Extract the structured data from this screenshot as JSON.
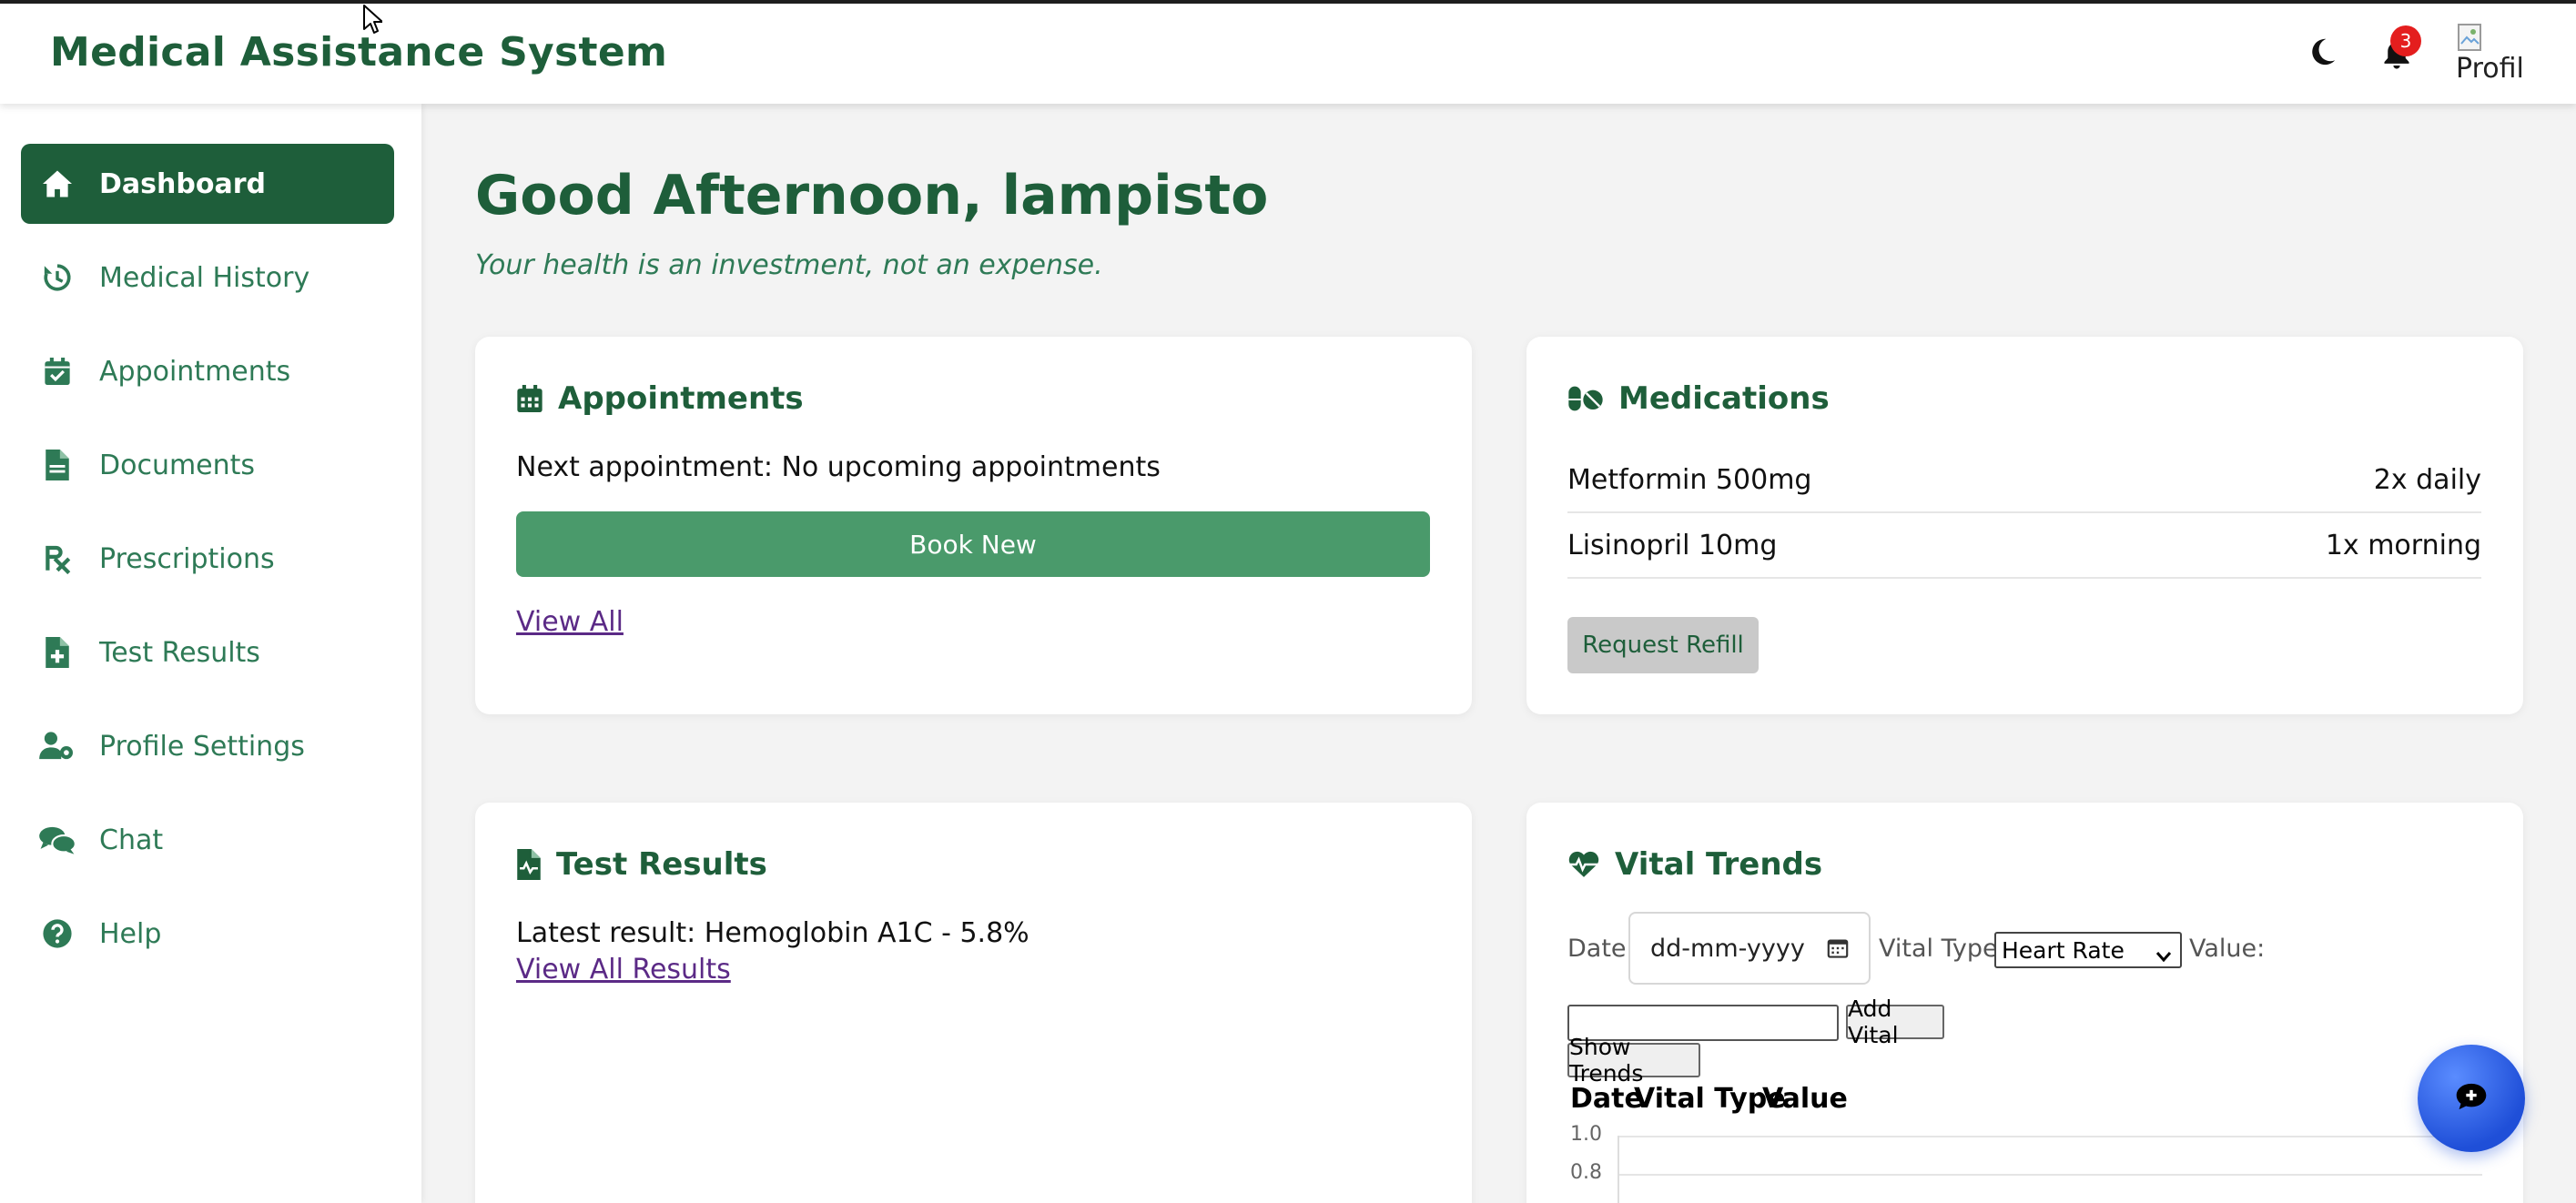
{
  "app": {
    "title": "Medical Assistance System",
    "notification_count": "3",
    "avatar_alt": "Profile"
  },
  "sidebar": {
    "items": [
      {
        "label": "Dashboard",
        "icon": "home-icon",
        "active": true
      },
      {
        "label": "Medical History",
        "icon": "history-icon"
      },
      {
        "label": "Appointments",
        "icon": "calendar-check-icon"
      },
      {
        "label": "Documents",
        "icon": "document-icon"
      },
      {
        "label": "Prescriptions",
        "icon": "prescription-icon"
      },
      {
        "label": "Test Results",
        "icon": "file-medical-icon"
      },
      {
        "label": "Profile Settings",
        "icon": "user-gear-icon"
      },
      {
        "label": "Chat",
        "icon": "chat-bubbles-icon"
      },
      {
        "label": "Help",
        "icon": "help-circle-icon"
      }
    ]
  },
  "main": {
    "greeting": "Good Afternoon, lampisto",
    "tagline": "Your health is an investment, not an expense."
  },
  "appointments": {
    "title": "Appointments",
    "next_text": "Next appointment: No upcoming appointments",
    "book_label": "Book New",
    "view_all_label": "View All"
  },
  "medications": {
    "title": "Medications",
    "items": [
      {
        "name": "Metformin 500mg",
        "schedule": "2x daily"
      },
      {
        "name": "Lisinopril 10mg",
        "schedule": "1x morning"
      }
    ],
    "refill_label": "Request Refill"
  },
  "test_results": {
    "title": "Test Results",
    "latest_text": "Latest result: Hemoglobin A1C - 5.8%",
    "view_all_label": "View All Results"
  },
  "vitals": {
    "title": "Vital Trends",
    "date_label": "Date:",
    "date_placeholder": "dd-mm-yyyy",
    "type_label": "Vital Type:",
    "type_selected": "Heart Rate",
    "value_label": "Value:",
    "add_label": "Add Vital",
    "show_trends_label": "Show Trends",
    "table_headers": [
      "Date",
      "Vital Type",
      "Value"
    ]
  },
  "chart_data": {
    "type": "line",
    "y_ticks": [
      "1.0",
      "0.8"
    ],
    "series": []
  },
  "colors": {
    "brand_dark": "#1e5e3a",
    "brand_mid": "#2e7a56",
    "button_green": "#4a9a6b",
    "badge_red": "#e41e1e",
    "fab_blue": "#1f4fd8"
  }
}
